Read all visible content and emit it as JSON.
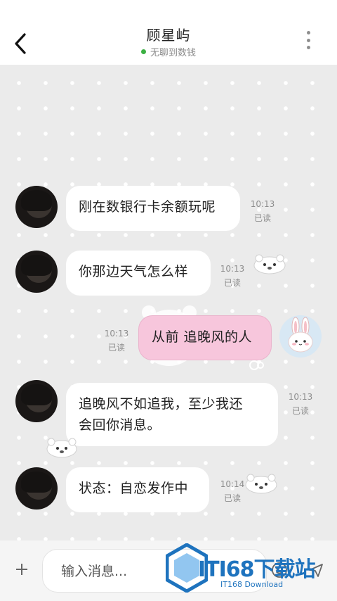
{
  "header": {
    "title": "顾星屿",
    "status": "无聊到数钱",
    "status_color": "#3cb043",
    "back_icon": "chevron-left-icon",
    "more_icon": "more-vertical-icon"
  },
  "messages": [
    {
      "side": "left",
      "text": "刚在数银行卡余额玩呢",
      "time": "10:13",
      "read": "已读"
    },
    {
      "side": "left",
      "text": "你那边天气怎么样",
      "time": "10:13",
      "read": "已读"
    },
    {
      "side": "right",
      "text": "从前 追晚风的人",
      "time": "10:13",
      "read": "已读"
    },
    {
      "side": "left",
      "text_line1": "追晚风不如追我，至少我还",
      "text_line2": "会回你消息。",
      "time": "10:13",
      "read": "已读"
    },
    {
      "side": "left",
      "text": "状态：自恋发作中",
      "time": "10:14",
      "read": "已读"
    }
  ],
  "input": {
    "placeholder": "输入消息...",
    "plus_icon": "plus-icon",
    "emoji_icon": "emoji-icon",
    "send_icon": "send-icon"
  },
  "watermark": {
    "main": "ITI68下载站",
    "sub": "IT168 Download"
  },
  "colors": {
    "my_bubble": "#f7c6dc",
    "their_bubble": "#ffffff",
    "chat_bg": "#ebebeb"
  }
}
